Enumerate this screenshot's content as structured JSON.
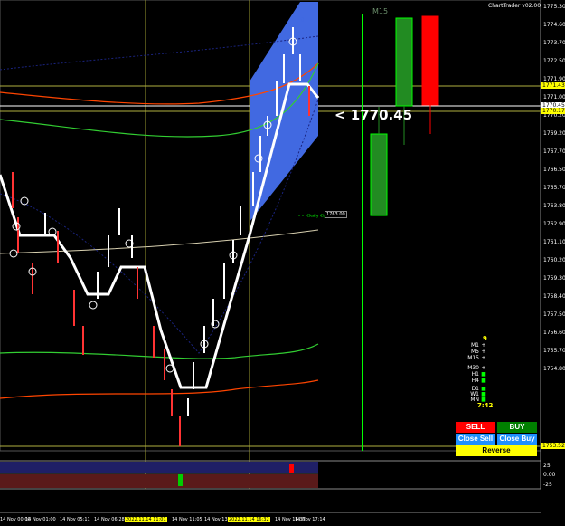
{
  "watermark": "ChartTrader v02.00",
  "timeframe_label": "M15",
  "price_callout": "< 1770.45",
  "daily_open_label": "Daily Open",
  "daily_open_value": "1763.00",
  "y_axis_ticks": [
    "1775.30",
    "1774.60",
    "1773.70",
    "1772.50",
    "1771.90",
    "1771.00",
    "1770.20",
    "1769.20",
    "1767.70",
    "1766.50",
    "1765.70",
    "1763.80",
    "1762.90",
    "1761.10",
    "1760.20",
    "1759.30",
    "1758.40",
    "1757.50",
    "1756.60",
    "1755.70",
    "1754.80"
  ],
  "price_tags": [
    {
      "text": "1771.43",
      "bg": "#ffff00",
      "fg": "#000000"
    },
    {
      "text": "1770.45",
      "bg": "#ffffff",
      "fg": "#000000"
    },
    {
      "text": "1770.17",
      "bg": "#ffff00",
      "fg": "#000000"
    },
    {
      "text": "1753.52",
      "bg": "#ffff00",
      "fg": "#000000"
    }
  ],
  "osc_ticks": [
    "25",
    "0.00",
    "-25"
  ],
  "time_axis": [
    "14 Nov 00:00",
    "14 Nov 01:00",
    "14 Nov 05:11",
    "14 Nov 06:28",
    "2022.11.14 11:01",
    "14 Nov 11:05",
    "14 Nov 13:47",
    "2022.11.14 16:32",
    "14 Nov 16:37",
    "14 Nov 17:14"
  ],
  "tf_panel": {
    "count": "9",
    "rows": [
      {
        "label": "M1",
        "mark": "+",
        "color": "#ffffff"
      },
      {
        "label": "M5",
        "mark": "+",
        "color": "#ffffff"
      },
      {
        "label": "M15",
        "mark": "+",
        "color": "#ffffff"
      },
      {
        "label": "M30",
        "mark": "+",
        "color": "#ffffff"
      },
      {
        "label": "H1",
        "mark": "■",
        "color": "#00ff00"
      },
      {
        "label": "H4",
        "mark": "■",
        "color": "#00ff00"
      },
      {
        "label": "D1",
        "mark": "■",
        "color": "#00ff00"
      },
      {
        "label": "W1",
        "mark": "■",
        "color": "#00ff00"
      },
      {
        "label": "MN",
        "mark": "■",
        "color": "#00ff00"
      }
    ],
    "timer": "7:42"
  },
  "buttons": {
    "sell": "SELL",
    "buy": "BUY",
    "close_sell": "Close Sell",
    "close_buy": "Close Buy",
    "reverse": "Reverse"
  },
  "colors": {
    "sell": "#ff0000",
    "buy": "#008000",
    "close": "#1e90ff",
    "reverse": "#ffff00",
    "channel": "#4169e1"
  }
}
